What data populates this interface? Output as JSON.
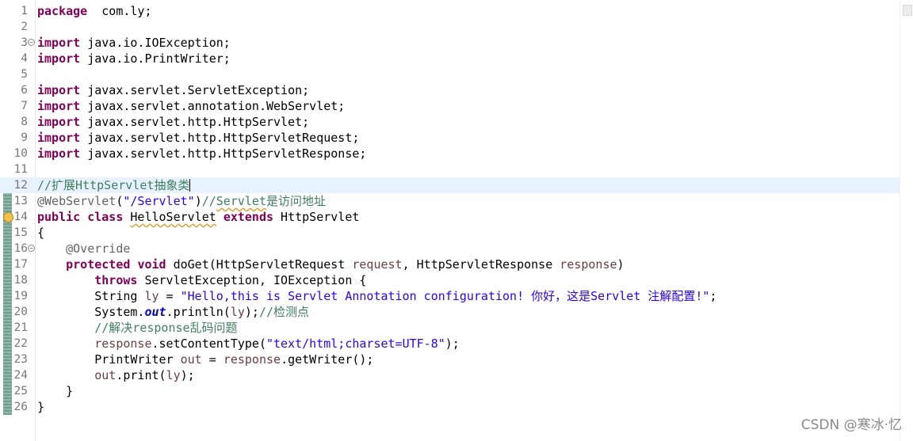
{
  "editor": {
    "lines": [
      {
        "n": "1",
        "segs": [
          [
            "kw",
            "package"
          ],
          [
            "",
            "  com.ly;"
          ]
        ]
      },
      {
        "n": "2",
        "segs": []
      },
      {
        "n": "3",
        "fold": true,
        "segs": [
          [
            "kw",
            "import"
          ],
          [
            "",
            " java.io.IOException;"
          ]
        ]
      },
      {
        "n": "4",
        "segs": [
          [
            "kw",
            "import"
          ],
          [
            "",
            " java.io.PrintWriter;"
          ]
        ]
      },
      {
        "n": "5",
        "segs": []
      },
      {
        "n": "6",
        "segs": [
          [
            "kw",
            "import"
          ],
          [
            "",
            " javax.servlet.ServletException;"
          ]
        ]
      },
      {
        "n": "7",
        "segs": [
          [
            "kw",
            "import"
          ],
          [
            "",
            " javax.servlet.annotation.WebServlet;"
          ]
        ]
      },
      {
        "n": "8",
        "segs": [
          [
            "kw",
            "import"
          ],
          [
            "",
            " javax.servlet.http.HttpServlet;"
          ]
        ]
      },
      {
        "n": "9",
        "segs": [
          [
            "kw",
            "import"
          ],
          [
            "",
            " javax.servlet.http.HttpServletRequest;"
          ]
        ]
      },
      {
        "n": "10",
        "segs": [
          [
            "kw",
            "import"
          ],
          [
            "",
            " javax.servlet.http.HttpServletResponse;"
          ]
        ]
      },
      {
        "n": "11",
        "segs": []
      },
      {
        "n": "12",
        "current": true,
        "caret": true,
        "segs": [
          [
            "cmt",
            "//扩展HttpServlet抽象类"
          ]
        ]
      },
      {
        "n": "13",
        "segs": [
          [
            "ann",
            "@WebServlet"
          ],
          [
            "",
            "("
          ],
          [
            "str",
            "\"/Servlet\""
          ],
          [
            "",
            ")"
          ],
          [
            "cmt",
            "//"
          ],
          [
            "cmt warn",
            "Servlet"
          ],
          [
            "cmt",
            "是访问地址"
          ]
        ]
      },
      {
        "n": "14",
        "marker": true,
        "segs": [
          [
            "kw",
            "public"
          ],
          [
            "",
            " "
          ],
          [
            "kw",
            "class"
          ],
          [
            "",
            " "
          ],
          [
            "warn",
            "HelloServlet"
          ],
          [
            "",
            " "
          ],
          [
            "kw",
            "extends"
          ],
          [
            "",
            " HttpServlet"
          ]
        ]
      },
      {
        "n": "15",
        "segs": [
          [
            "",
            "{"
          ]
        ]
      },
      {
        "n": "16",
        "fold": true,
        "segs": [
          [
            "",
            "    "
          ],
          [
            "ann",
            "@Override"
          ]
        ]
      },
      {
        "n": "17",
        "segs": [
          [
            "",
            "    "
          ],
          [
            "kw",
            "protected"
          ],
          [
            "",
            " "
          ],
          [
            "kw",
            "void"
          ],
          [
            "",
            " doGet(HttpServletRequest "
          ],
          [
            "var",
            "request"
          ],
          [
            "",
            ", HttpServletResponse "
          ],
          [
            "var",
            "response"
          ],
          [
            "",
            ")"
          ]
        ]
      },
      {
        "n": "18",
        "segs": [
          [
            "",
            "        "
          ],
          [
            "kw",
            "throws"
          ],
          [
            "",
            " ServletException, IOException {"
          ]
        ]
      },
      {
        "n": "19",
        "segs": [
          [
            "",
            "        String "
          ],
          [
            "var",
            "ly"
          ],
          [
            "",
            " = "
          ],
          [
            "str",
            "\"Hello,this is Servlet Annotation configuration! 你好，这是Servlet 注解配置!\""
          ],
          [
            "",
            ";"
          ]
        ]
      },
      {
        "n": "20",
        "segs": [
          [
            "",
            "        System."
          ],
          [
            "sfld",
            "out"
          ],
          [
            "",
            ".println("
          ],
          [
            "var",
            "ly"
          ],
          [
            "",
            ");"
          ],
          [
            "cmt",
            "//检测点"
          ]
        ]
      },
      {
        "n": "21",
        "segs": [
          [
            "",
            "        "
          ],
          [
            "cmt",
            "//解决response乱码问题"
          ]
        ]
      },
      {
        "n": "22",
        "segs": [
          [
            "",
            "        "
          ],
          [
            "var",
            "response"
          ],
          [
            "",
            ".setContentType("
          ],
          [
            "str",
            "\"text/html;charset=UTF-8\""
          ],
          [
            "",
            ");"
          ]
        ]
      },
      {
        "n": "23",
        "segs": [
          [
            "",
            "        PrintWriter "
          ],
          [
            "var",
            "out"
          ],
          [
            "",
            " = "
          ],
          [
            "var",
            "response"
          ],
          [
            "",
            ".getWriter();"
          ]
        ]
      },
      {
        "n": "24",
        "segs": [
          [
            "",
            "        "
          ],
          [
            "var",
            "out"
          ],
          [
            "",
            ".print("
          ],
          [
            "var",
            "ly"
          ],
          [
            "",
            ");"
          ]
        ]
      },
      {
        "n": "25",
        "segs": [
          [
            "",
            "    }"
          ]
        ]
      },
      {
        "n": "26",
        "segs": [
          [
            "",
            "}"
          ]
        ]
      }
    ]
  },
  "watermark": "CSDN @寒冰·忆"
}
